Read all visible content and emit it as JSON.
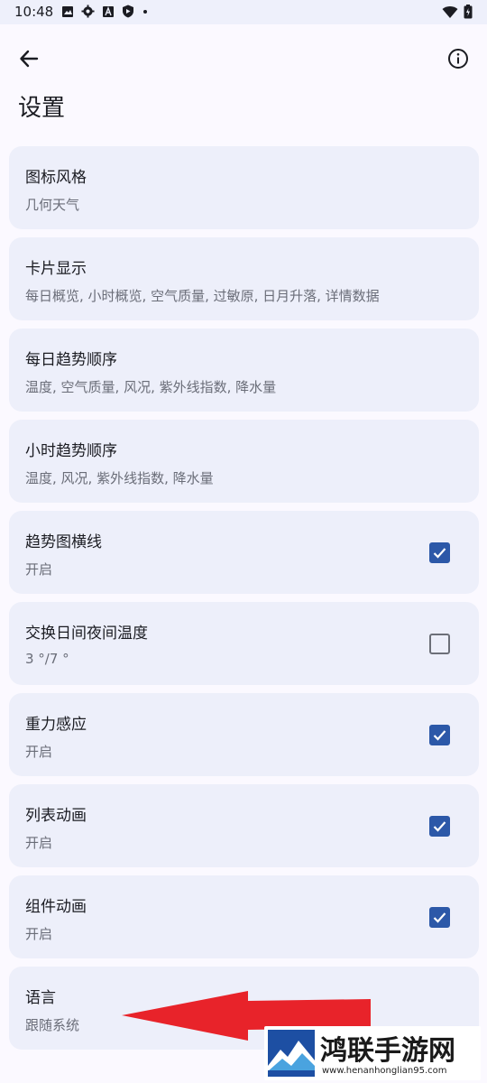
{
  "status_bar": {
    "time": "10:48",
    "icons": [
      "image-icon",
      "gear-icon",
      "a-icon",
      "shield-icon",
      "dot-icon"
    ],
    "right_icons": [
      "wifi-icon",
      "battery-icon"
    ]
  },
  "header": {
    "title": "设置"
  },
  "settings": [
    {
      "title": "图标风格",
      "subtitle": "几何天气",
      "checkbox": null
    },
    {
      "title": "卡片显示",
      "subtitle": "每日概览, 小时概览, 空气质量, 过敏原, 日月升落, 详情数据",
      "checkbox": null
    },
    {
      "title": "每日趋势顺序",
      "subtitle": "温度, 空气质量, 风况, 紫外线指数, 降水量",
      "checkbox": null
    },
    {
      "title": "小时趋势顺序",
      "subtitle": "温度, 风况, 紫外线指数, 降水量",
      "checkbox": null
    },
    {
      "title": "趋势图横线",
      "subtitle": "开启",
      "checkbox": true
    },
    {
      "title": "交换日间夜间温度",
      "subtitle": "3 °/7 °",
      "checkbox": false
    },
    {
      "title": "重力感应",
      "subtitle": "开启",
      "checkbox": true
    },
    {
      "title": "列表动画",
      "subtitle": "开启",
      "checkbox": true
    },
    {
      "title": "组件动画",
      "subtitle": "开启",
      "checkbox": true
    },
    {
      "title": "语言",
      "subtitle": "跟随系统",
      "checkbox": null
    }
  ],
  "watermark": {
    "name": "鸿联手游网",
    "url": "www.henanhonglian95.com"
  },
  "colors": {
    "background": "#fbf9ff",
    "card": "#edeffa",
    "checkbox_on": "#2c58a8",
    "arrow": "#e8232a"
  }
}
